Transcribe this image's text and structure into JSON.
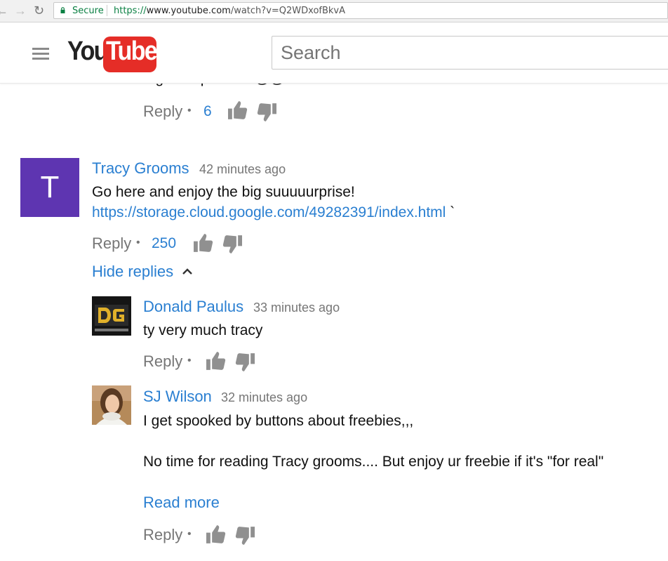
{
  "browser": {
    "secure_label": "Secure",
    "url_scheme": "https://",
    "url_host": "www.youtube.com",
    "url_path": "/watch?v=Q2WDxofBkvA"
  },
  "header": {
    "logo_you": "You",
    "logo_tube": "Tube",
    "search_placeholder": "Search"
  },
  "previous_comment": {
    "partial_text": "a get surprise~ lll@@!",
    "reply_label": "Reply",
    "likes": "6"
  },
  "comment": {
    "avatar_letter": "T",
    "author": "Tracy Grooms",
    "time": "42 minutes ago",
    "text": "Go here and enjoy the big suuuuurprise!",
    "link": "https://storage.cloud.google.com/49282391/index.html",
    "link_suffix": "`",
    "reply_label": "Reply",
    "likes": "250",
    "hide_replies_label": "Hide replies"
  },
  "replies": [
    {
      "author": "Donald Paulus",
      "time": "33 minutes ago",
      "text": "ty very much tracy",
      "reply_label": "Reply"
    },
    {
      "author": "SJ Wilson",
      "time": "32 minutes ago",
      "text_line1": "I get spooked by buttons about freebies,,,",
      "text_line2": "No time for reading Tracy grooms.... But enjoy ur freebie if it's \"for real\"",
      "read_more_label": "Read more",
      "reply_label": "Reply"
    }
  ],
  "colors": {
    "accent_blue": "#2a7fd1",
    "youtube_red": "#e52d27",
    "avatar_purple": "#5e35b1",
    "secure_green": "#0b8043"
  }
}
